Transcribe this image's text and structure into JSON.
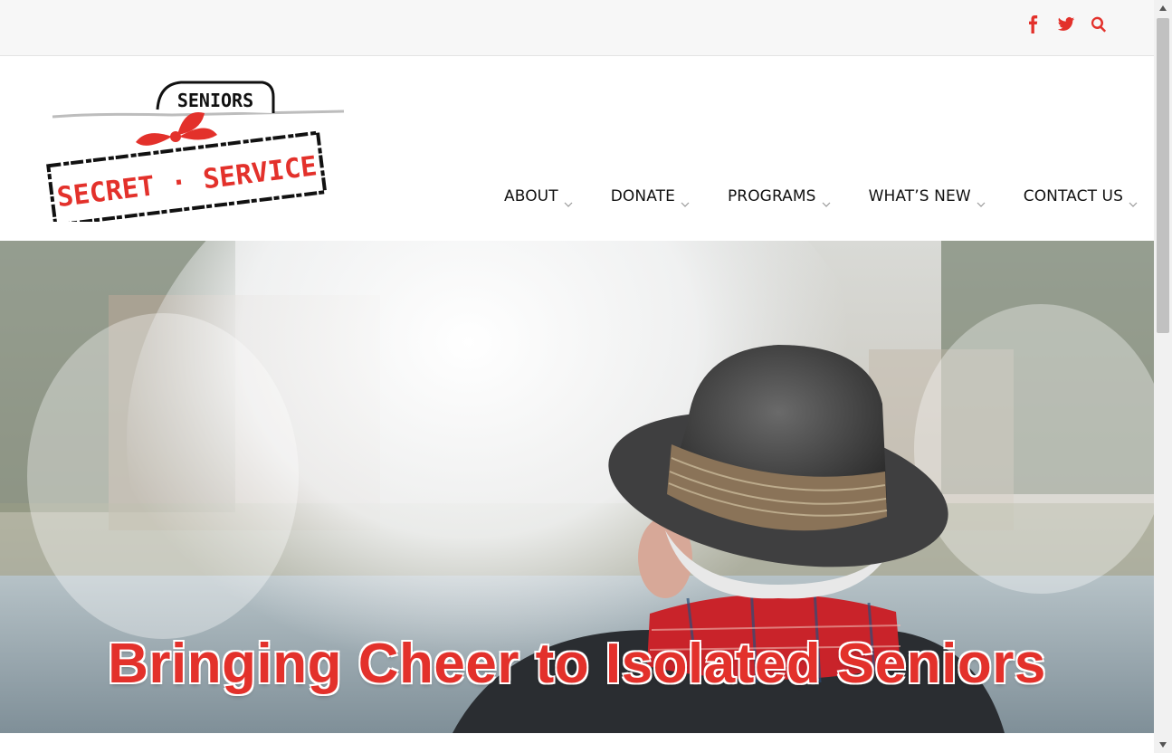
{
  "social": {
    "facebook_icon": "facebook-icon",
    "twitter_icon": "twitter-icon",
    "search_icon": "search-icon"
  },
  "logo": {
    "top_text": "SENIORS",
    "main_text": "SECRET · SERVICE"
  },
  "nav": {
    "items": [
      {
        "label": "ABOUT"
      },
      {
        "label": "DONATE"
      },
      {
        "label": "PROGRAMS"
      },
      {
        "label": "WHAT’S NEW"
      },
      {
        "label": "CONTACT US"
      }
    ]
  },
  "hero": {
    "title": "Bringing Cheer to Isolated Seniors"
  },
  "colors": {
    "accent": "#e3312b",
    "topbar_bg": "#f7f7f7",
    "nav_text": "#111111"
  }
}
